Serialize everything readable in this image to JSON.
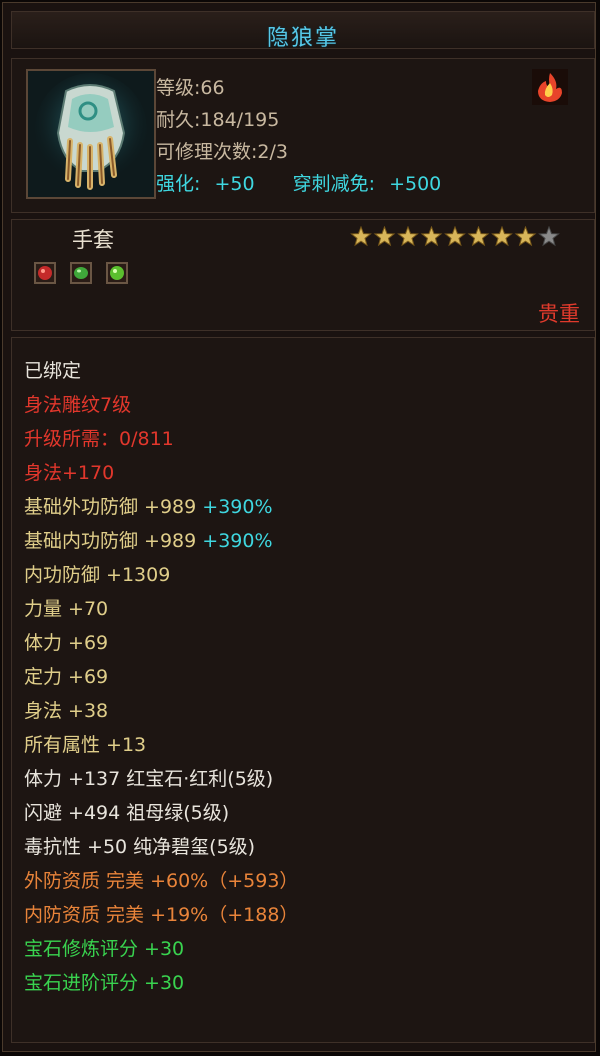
{
  "title": "隐狼掌",
  "item": {
    "level": "等级:66",
    "durability": "耐久:184/195",
    "repair": "可修理次数:2/3",
    "enhance_label": "强化:",
    "enhance_value": "+50",
    "pierce_label": "穿刺减免:",
    "pierce_value": "+500",
    "type": "手套",
    "valuable": "贵重",
    "stars_filled": 8,
    "stars_total": 9
  },
  "gems": [
    {
      "name": "red-gem-icon",
      "color": "#c42a2a"
    },
    {
      "name": "green-gem-icon",
      "color": "#3fa83a"
    },
    {
      "name": "green-gem-icon",
      "color": "#5bbf2e"
    }
  ],
  "attributes": [
    {
      "text": "已绑定",
      "color": "white"
    },
    {
      "text": "身法雕纹7级",
      "color": "red"
    },
    {
      "text": "升级所需：0/811",
      "color": "red"
    },
    {
      "text": "身法+170",
      "color": "red"
    },
    {
      "text": "基础外功防御 +989",
      "extra": " +390%",
      "color": "gold",
      "extra_color": "cyan"
    },
    {
      "text": "基础内功防御 +989",
      "extra": " +390%",
      "color": "gold",
      "extra_color": "cyan"
    },
    {
      "text": "内功防御 +1309",
      "color": "gold"
    },
    {
      "text": "力量 +70",
      "color": "gold"
    },
    {
      "text": "体力 +69",
      "color": "gold"
    },
    {
      "text": "定力 +69",
      "color": "gold"
    },
    {
      "text": "身法 +38",
      "color": "gold"
    },
    {
      "text": "所有属性 +13",
      "color": "gold"
    },
    {
      "text": "体力 +137 红宝石·红利(5级)",
      "color": "white"
    },
    {
      "text": "闪避 +494 祖母绿(5级)",
      "color": "white"
    },
    {
      "text": "毒抗性 +50 纯净碧玺(5级)",
      "color": "white"
    },
    {
      "text": "外防资质   完美 +60%（+593）",
      "color": "orange"
    },
    {
      "text": "内防资质   完美 +19%（+188）",
      "color": "orange"
    },
    {
      "text": "宝石修炼评分 +30",
      "color": "green"
    },
    {
      "text": "宝石进阶评分 +30",
      "color": "green"
    }
  ]
}
